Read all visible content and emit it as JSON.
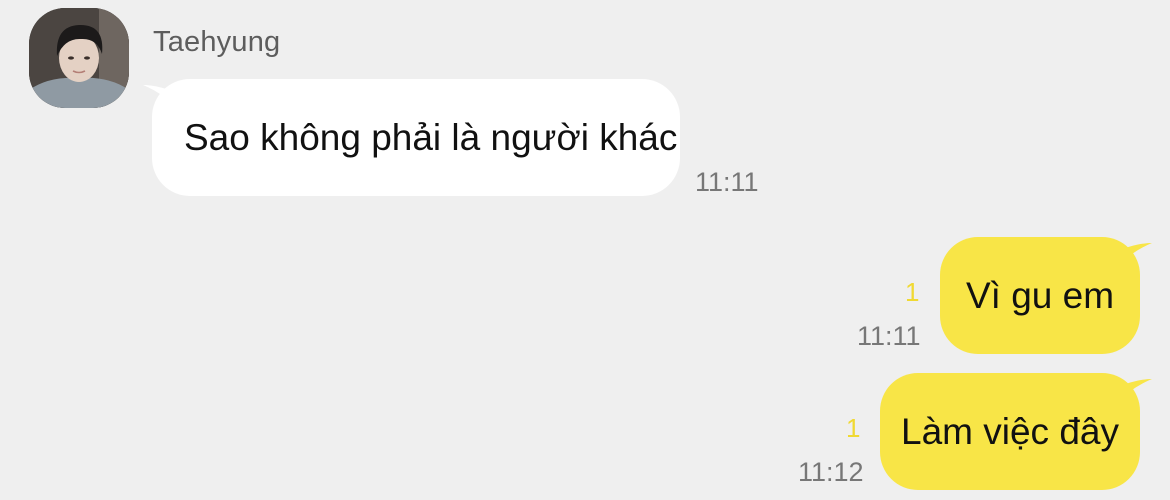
{
  "contact": {
    "name": "Taehyung",
    "avatar_icon": "profile-photo"
  },
  "messages": [
    {
      "direction": "incoming",
      "text": "Sao không phải là người khác",
      "time": "11:11"
    },
    {
      "direction": "outgoing",
      "text": "Vì gu em",
      "time": "11:11",
      "unread_count": "1"
    },
    {
      "direction": "outgoing",
      "text": "Làm việc đây",
      "time": "11:12",
      "unread_count": "1"
    }
  ],
  "colors": {
    "background": "#efefef",
    "incoming_bubble": "#ffffff",
    "outgoing_bubble": "#f8e547",
    "unread_count": "#f0d932"
  }
}
